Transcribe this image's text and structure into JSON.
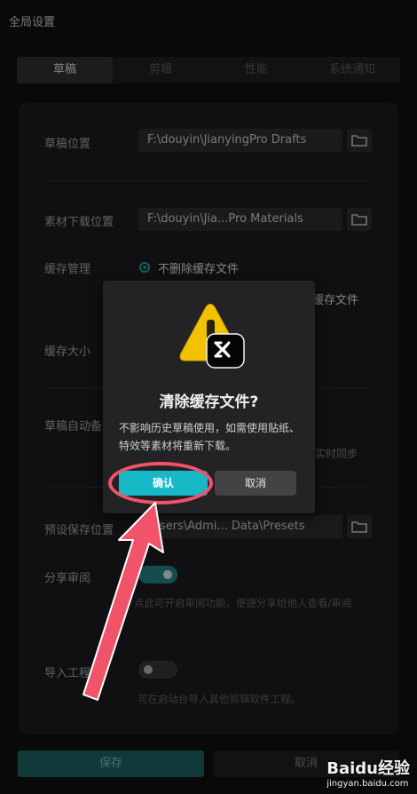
{
  "window": {
    "title": "全局设置"
  },
  "tabs": [
    {
      "label": "草稿",
      "active": true
    },
    {
      "label": "剪辑",
      "active": false
    },
    {
      "label": "性能",
      "active": false
    },
    {
      "label": "系统通知",
      "active": false
    }
  ],
  "settings": {
    "draft_location": {
      "label": "草稿位置",
      "value": "F:\\douyin\\JianyingPro Drafts"
    },
    "material_download": {
      "label": "素材下载位置",
      "value": "F:\\douyin\\Jia...Pro Materials"
    },
    "cache_management": {
      "label": "缓存管理",
      "option_selected": "不删除缓存文件",
      "option_partial": "缓存文件"
    },
    "cache_size": {
      "label": "缓存大小"
    },
    "draft_autosave": {
      "label": "草稿自动备",
      "partial_text": "实时同步"
    },
    "preset_location": {
      "label": "预设保存位置",
      "value": "\\Users\\Admi... Data\\Presets"
    },
    "share_review": {
      "label": "分享审阅",
      "enabled": true,
      "hint": "点此可开启审阅功能，便捷分享给他人查看/审阅"
    },
    "import_project": {
      "label": "导入工程",
      "enabled": false,
      "hint": "可在启动台导入其他剪辑软件工程。"
    }
  },
  "footer": {
    "save_label": "保存",
    "cancel_label": "取消"
  },
  "dialog": {
    "title": "清除缓存文件?",
    "message": "不影响历史草稿使用，如需使用贴纸、特效等素材将重新下载。",
    "confirm_label": "确认",
    "cancel_label": "取消",
    "warning_color": "#f2c200",
    "confirm_color": "#17b9c7"
  },
  "annotation": {
    "color": "#f0536a"
  },
  "watermark": {
    "brand": "Baidu经验",
    "url": "jingyan.baidu.com"
  },
  "colors": {
    "accent": "#1f9c9a",
    "background": "#0f0f10",
    "panel": "#1b1b1d"
  }
}
